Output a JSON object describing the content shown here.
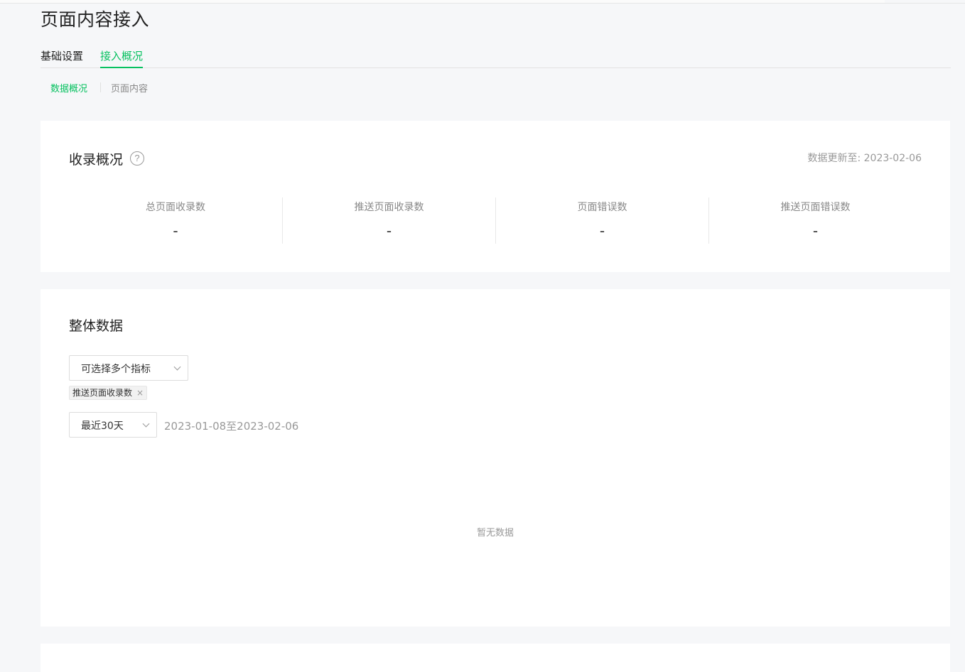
{
  "page": {
    "title": "页面内容接入"
  },
  "tabs": [
    {
      "label": "基础设置"
    },
    {
      "label": "接入概况"
    }
  ],
  "subtabs": [
    {
      "label": "数据概况"
    },
    {
      "label": "页面内容"
    }
  ],
  "overview_card": {
    "title": "收录概况",
    "help_icon": "?",
    "update_label": "数据更新至:",
    "update_value": "2023-02-06",
    "stats": [
      {
        "label": "总页面收录数",
        "value": "-"
      },
      {
        "label": "推送页面收录数",
        "value": "-"
      },
      {
        "label": "页面错误数",
        "value": "-"
      },
      {
        "label": "推送页面错误数",
        "value": "-"
      }
    ]
  },
  "overall_card": {
    "title": "整体数据",
    "metric_select": {
      "placeholder": "可选择多个指标"
    },
    "selected_tags": [
      {
        "label": "推送页面收录数",
        "close": "×"
      }
    ],
    "range_select": {
      "value": "最近30天"
    },
    "date_range": "2023-01-08至2023-02-06",
    "empty_text": "暂无数据"
  },
  "colors": {
    "accent": "#07c160",
    "background": "#f6f7f9"
  }
}
